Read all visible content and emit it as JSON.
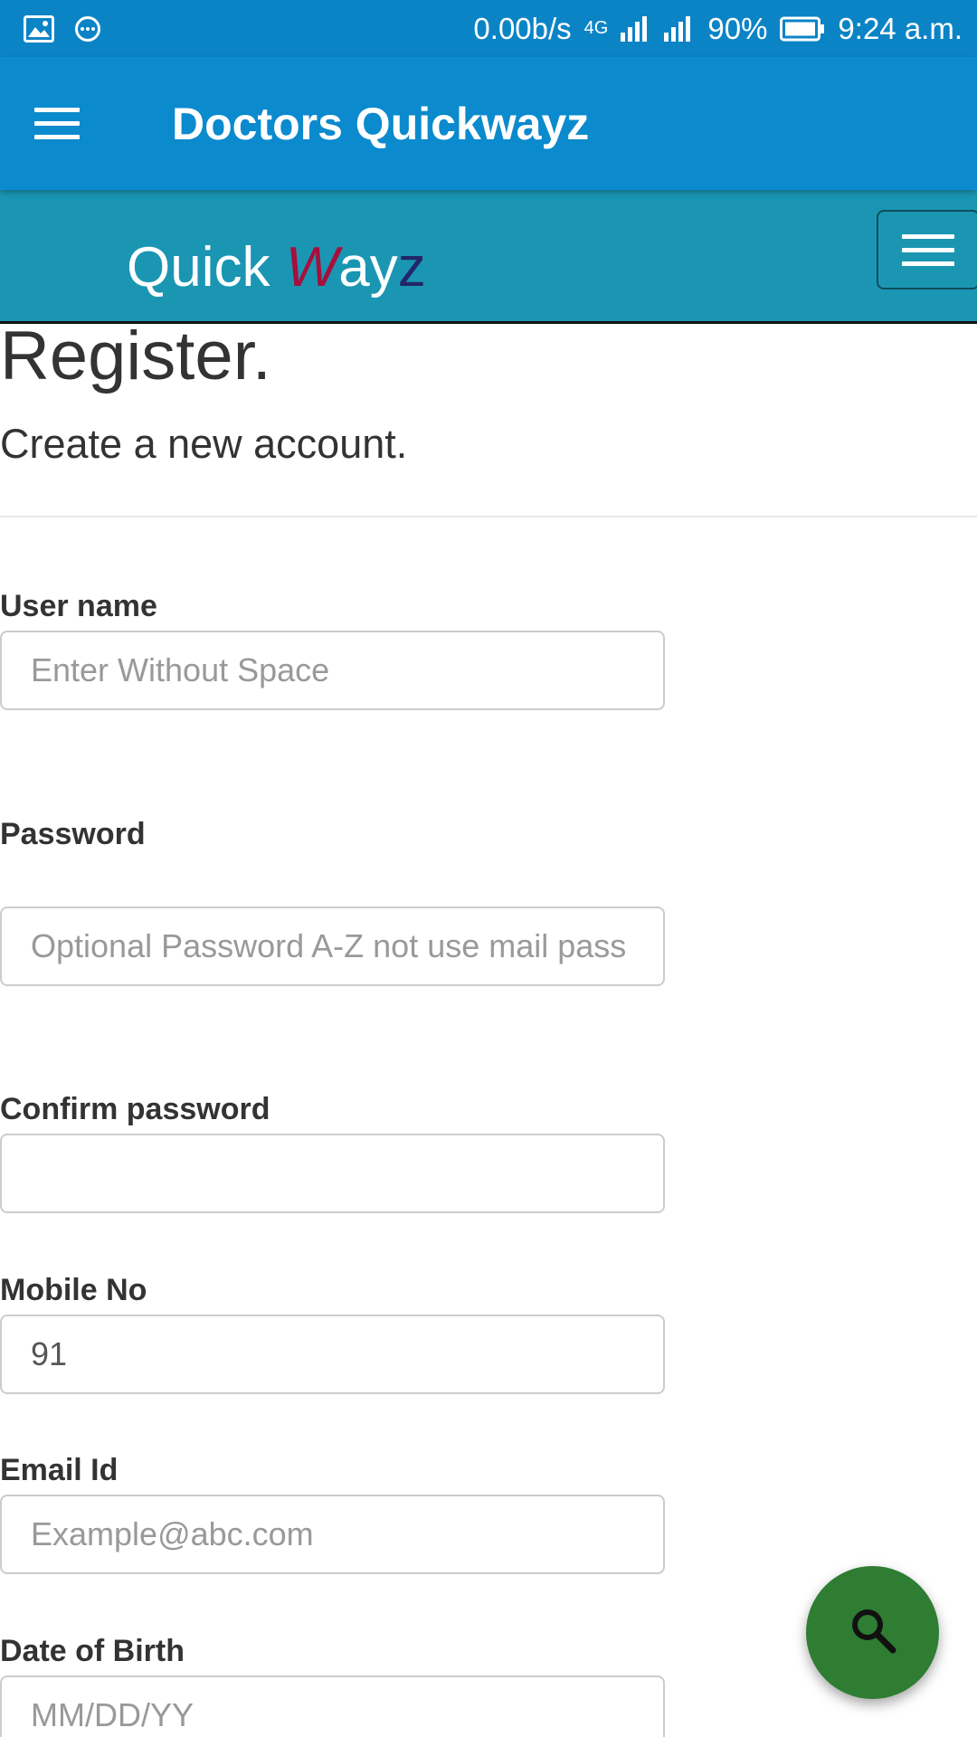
{
  "status_bar": {
    "speed": "0.00b/s",
    "network": "4G",
    "battery": "90%",
    "time": "9:24 a.m.",
    "icons": [
      "image-icon",
      "message-icon",
      "signal-icon",
      "battery-icon"
    ]
  },
  "app_bar": {
    "title": "Doctors Quickwayz",
    "menu_icon": "hamburger-menu-icon"
  },
  "site_nav": {
    "brand_part1": "Quick ",
    "brand_w": "W",
    "brand_ay": "ay",
    "brand_z": "z",
    "toggle_icon": "hamburger-menu-icon"
  },
  "page": {
    "heading": "Register.",
    "subheading": "Create a new account."
  },
  "form": {
    "username": {
      "label": "User name",
      "placeholder": "Enter Without Space"
    },
    "password": {
      "label": "Password",
      "placeholder": "Optional Password A-Z not use mail pass"
    },
    "confirm_password": {
      "label": "Confirm password"
    },
    "mobile": {
      "label": "Mobile No",
      "value": "91"
    },
    "email": {
      "label": "Email Id",
      "placeholder": "Example@abc.com"
    },
    "dob": {
      "label": "Date of Birth",
      "placeholder": "MM/DD/YY"
    }
  },
  "fab": {
    "icon": "search-icon"
  },
  "colors": {
    "status_bar": "#0b84c6",
    "app_bar": "#0b8acd",
    "site_nav": "#1a96b3",
    "brand_w": "#a5103c",
    "brand_z": "#23266a",
    "fab": "#2e7d32"
  }
}
